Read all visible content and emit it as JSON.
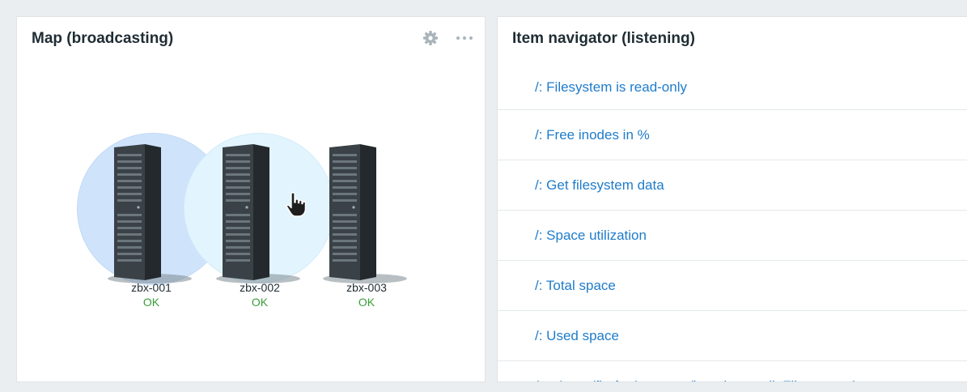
{
  "map_widget": {
    "title": "Map (broadcasting)",
    "actions": [
      "gear-icon",
      "more-icon"
    ],
    "hosts": [
      {
        "name": "zbx-001",
        "status": "OK",
        "highlight": "selected"
      },
      {
        "name": "zbx-002",
        "status": "OK",
        "highlight": "hover"
      },
      {
        "name": "zbx-003",
        "status": "OK",
        "highlight": "none"
      }
    ],
    "status_color": "#3a9e3a"
  },
  "navigator_widget": {
    "title": "Item navigator (listening)",
    "items": [
      "/: Filesystem is read-only",
      "/: Free inodes in %",
      "/: Get filesystem data",
      "/: Space utilization",
      "/: Total space",
      "/: Used space",
      "/var/snap/firefox/common/host-hunspell: Filesystem is r"
    ],
    "link_color": "#1f7ccb"
  }
}
